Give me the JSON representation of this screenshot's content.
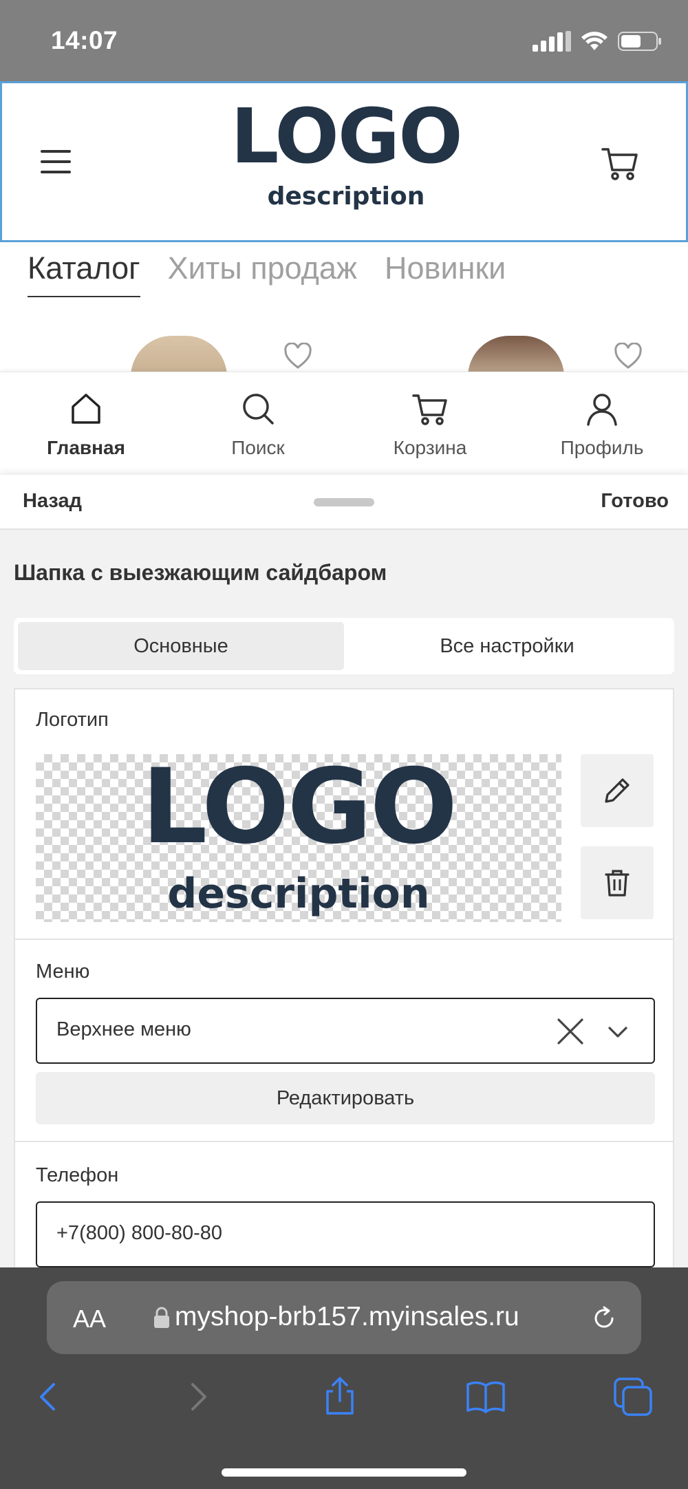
{
  "status": {
    "time": "14:07"
  },
  "header": {
    "logo": "LOGO",
    "description": "description",
    "icons": [
      "menu-icon",
      "cart-icon"
    ]
  },
  "catalog_tabs": [
    {
      "label": "Каталог",
      "active": true
    },
    {
      "label": "Хиты продаж",
      "active": false
    },
    {
      "label": "Новинки",
      "active": false
    }
  ],
  "bottom_nav": [
    {
      "label": "Главная",
      "icon": "home-icon",
      "active": true
    },
    {
      "label": "Поиск",
      "icon": "search-icon",
      "active": false
    },
    {
      "label": "Корзина",
      "icon": "cart-icon",
      "active": false
    },
    {
      "label": "Профиль",
      "icon": "profile-icon",
      "active": false
    }
  ],
  "sheet": {
    "back": "Назад",
    "done": "Готово",
    "title": "Шапка с выезжающим сайдбаром",
    "tabs": [
      {
        "label": "Основные",
        "active": true
      },
      {
        "label": "Все настройки",
        "active": false
      }
    ],
    "logo_field": {
      "label": "Логотип",
      "preview_logo": "LOGO",
      "preview_description": "description"
    },
    "menu_field": {
      "label": "Меню",
      "value": "Верхнее меню",
      "edit": "Редактировать"
    },
    "phone_field": {
      "label": "Телефон",
      "value": "+7(800) 800-80-80"
    }
  },
  "browser": {
    "text_size": "AA",
    "url": "myshop-brb157.myinsales.ru"
  }
}
